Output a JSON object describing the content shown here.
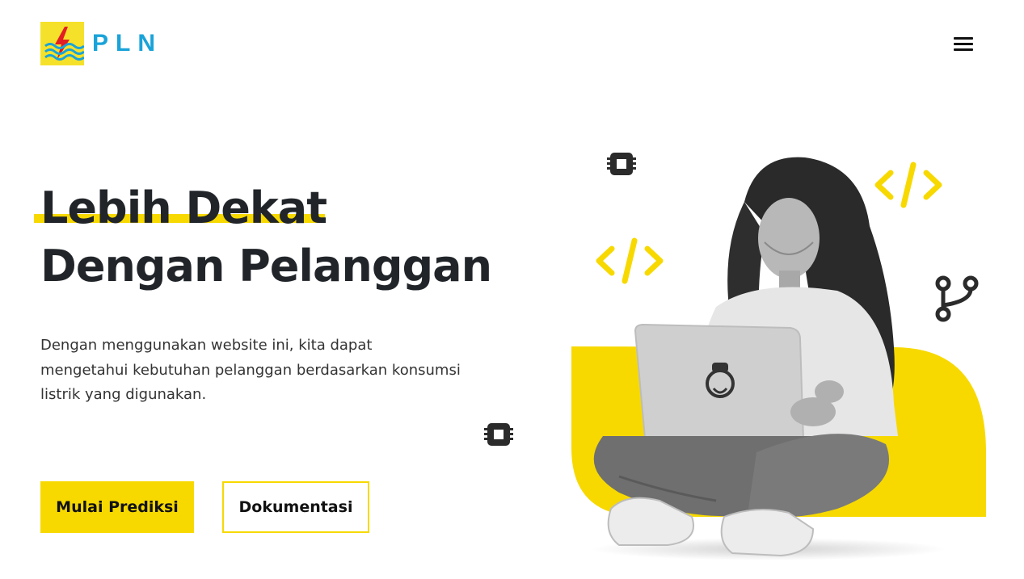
{
  "brand": {
    "name": "PLN",
    "colors": {
      "yellow": "#f7d900",
      "blue": "#1aa3d9",
      "red": "#e31e24",
      "dark": "#212529"
    }
  },
  "nav": {
    "menu_icon": "hamburger-icon"
  },
  "hero": {
    "title_line1": "Lebih Dekat",
    "title_line2": "Dengan Pelanggan",
    "description": "Dengan menggunakan website ini, kita dapat mengetahui kebutuhan pelanggan berdasarkan konsumsi listrik yang digunakan.",
    "primary_button": "Mulai Prediksi",
    "secondary_button": "Dokumentasi"
  },
  "decorations": {
    "icons": [
      "cpu-chip-icon",
      "code-brackets-icon",
      "git-branch-icon",
      "cpu-chip-icon",
      "code-brackets-icon"
    ]
  }
}
